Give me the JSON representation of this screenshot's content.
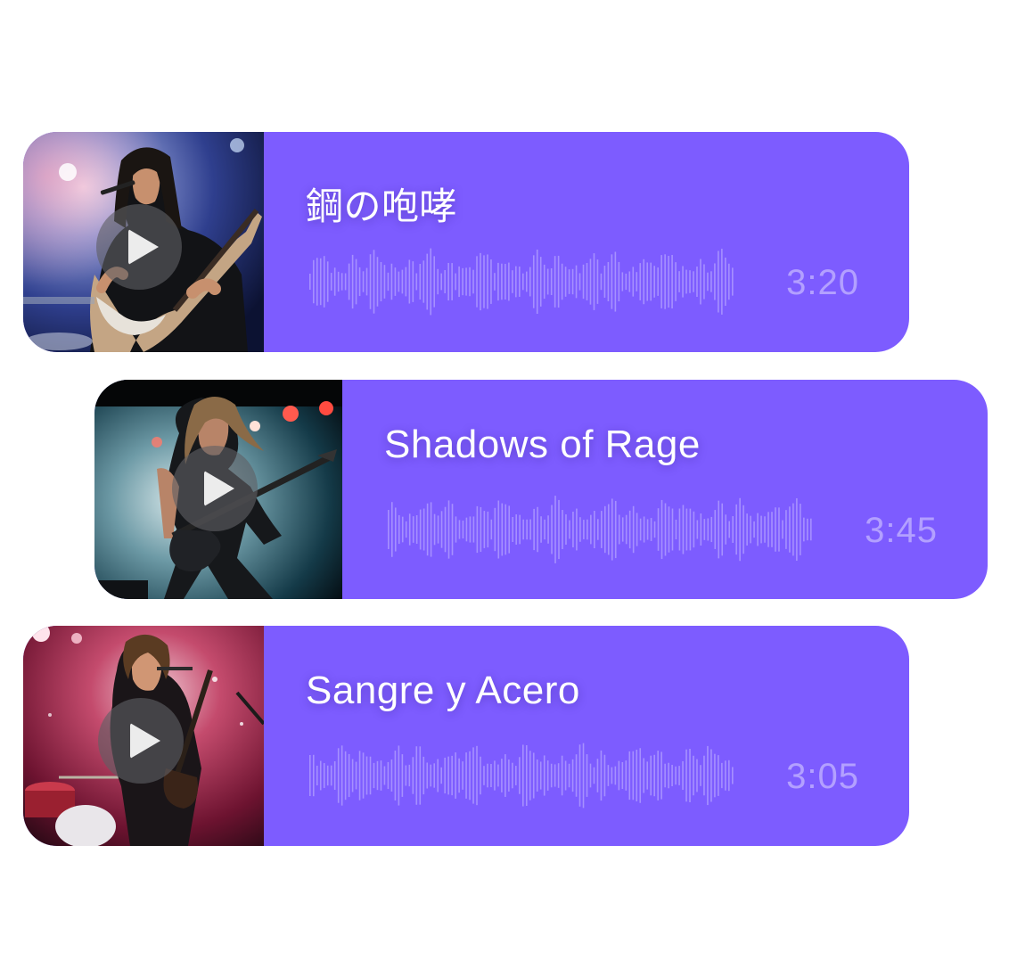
{
  "tracks": [
    {
      "title": "鋼の咆哮",
      "duration": "3:20",
      "card_color": "#7d5cff",
      "thumbnail": "concert-photo-long-haired-singer-with-guitar-blue-stage-lights",
      "play_icon": "play-icon"
    },
    {
      "title": "Shadows of Rage",
      "duration": "3:45",
      "card_color": "#7d5cff",
      "thumbnail": "concert-photo-guitarist-smoke-teal-and-red-lights",
      "play_icon": "play-icon"
    },
    {
      "title": "Sangre y Acero",
      "duration": "3:05",
      "card_color": "#7d5cff",
      "thumbnail": "concert-photo-singer-guitarist-red-stage-lights-drums",
      "play_icon": "play-icon"
    }
  ]
}
